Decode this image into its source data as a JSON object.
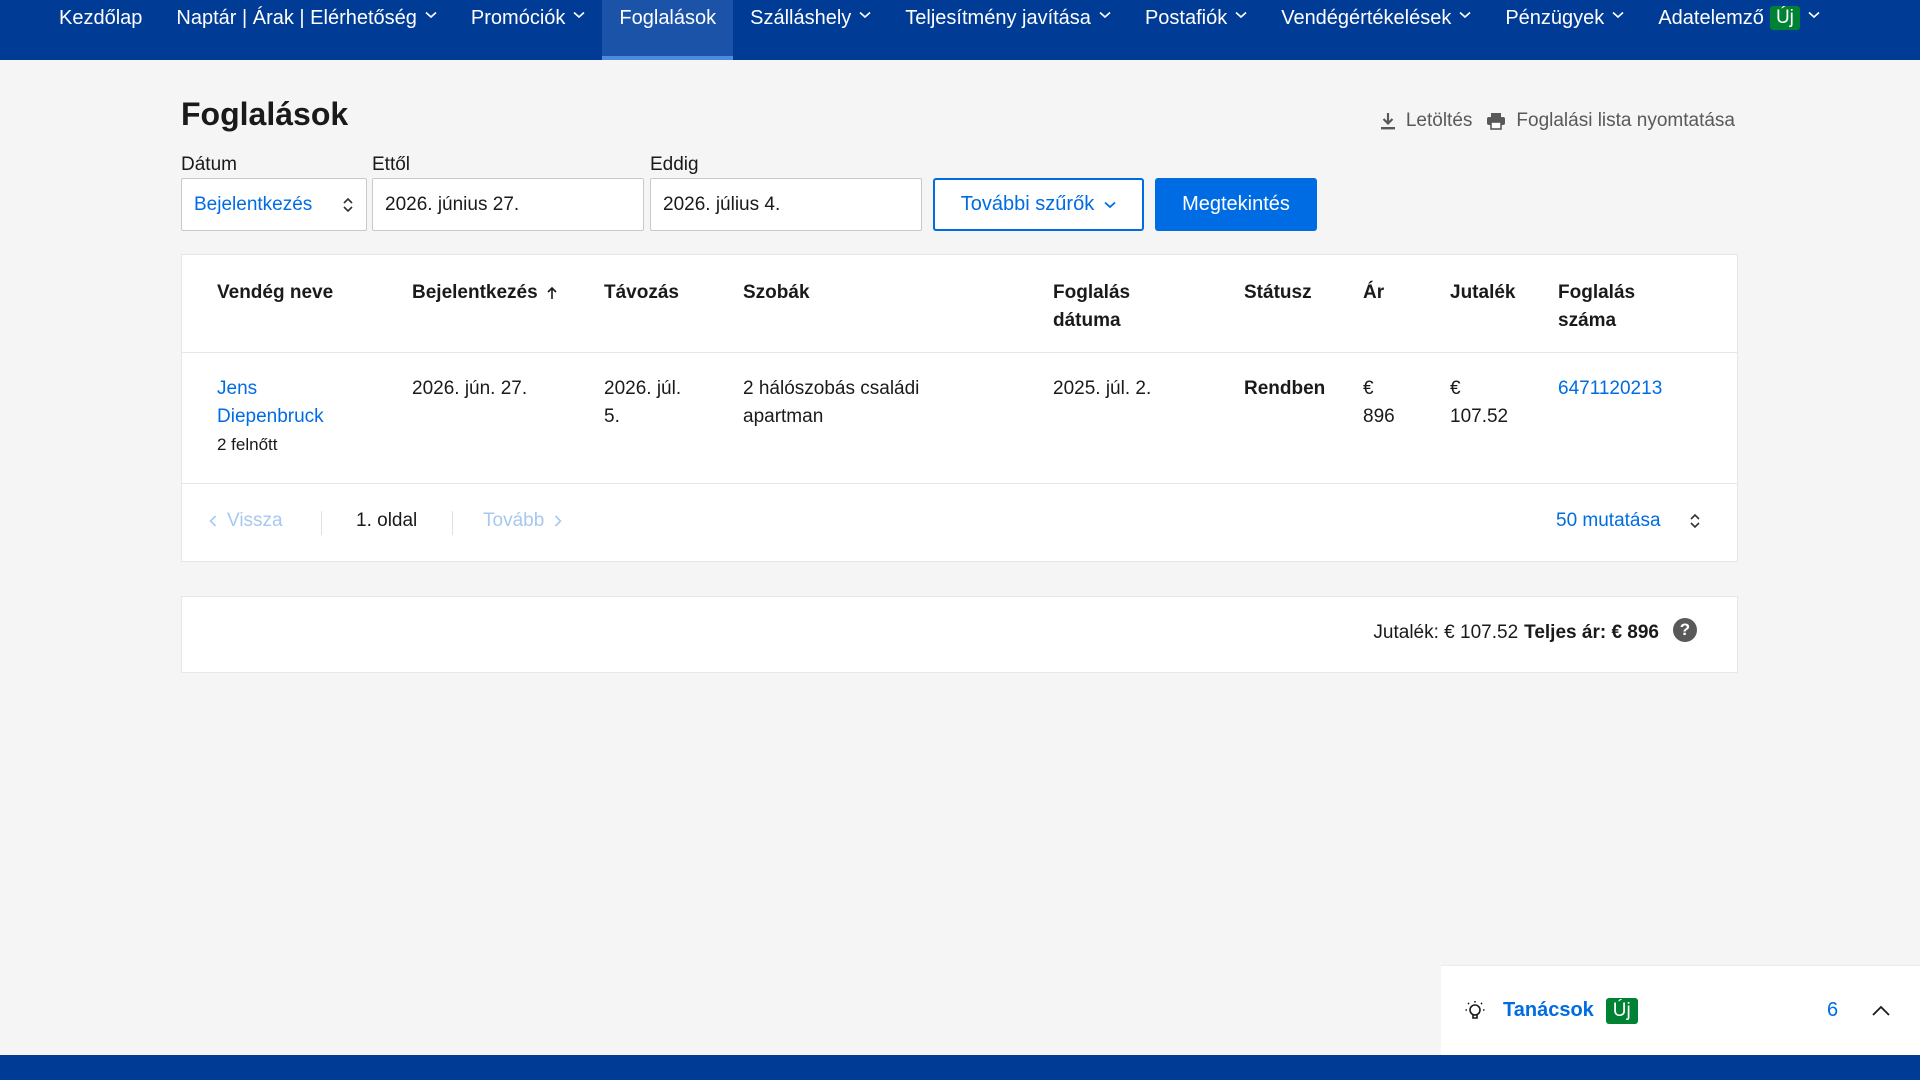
{
  "nav": {
    "items": [
      {
        "label": "Kezdőlap",
        "dropdown": false
      },
      {
        "label": "Naptár | Árak | Elérhetőség",
        "dropdown": true
      },
      {
        "label": "Promóciók",
        "dropdown": true
      },
      {
        "label": "Foglalások",
        "dropdown": false,
        "active": true
      },
      {
        "label": "Szálláshely",
        "dropdown": true
      },
      {
        "label": "Teljesítmény javítása",
        "dropdown": true
      },
      {
        "label": "Postafiók",
        "dropdown": true
      },
      {
        "label": "Vendégértékelések",
        "dropdown": true
      },
      {
        "label": "Pénzügyek",
        "dropdown": true
      },
      {
        "label": "Adatelemző",
        "dropdown": true,
        "badge": "Új"
      }
    ]
  },
  "page": {
    "title": "Foglalások",
    "download_label": "Letöltés",
    "print_label": "Foglalási lista nyomtatása"
  },
  "filters": {
    "date_label": "Dátum",
    "date_type_value": "Bejelentkezés",
    "from_label": "Ettől",
    "from_value": "2026. június 27.",
    "to_label": "Eddig",
    "to_value": "2026. július 4.",
    "more_filters_label": "További szűrők",
    "view_button_label": "Megtekintés"
  },
  "table": {
    "headers": {
      "guest": "Vendég neve",
      "checkin": "Bejelentkezés",
      "checkout": "Távozás",
      "rooms": "Szobák",
      "booking_date_1": "Foglalás",
      "booking_date_2": "dátuma",
      "status": "Státusz",
      "price": "Ár",
      "commission": "Jutalék",
      "booking_no_1": "Foglalás",
      "booking_no_2": "száma"
    },
    "sort": {
      "column": "checkin",
      "direction": "ascending"
    },
    "rows": [
      {
        "guest_first": "Jens",
        "guest_last": "Diepenbruck",
        "guests": "2 felnőtt",
        "checkin": "2026. jún. 27.",
        "checkout_1": "2026. júl.",
        "checkout_2": "5.",
        "rooms_1": "2 hálószobás családi",
        "rooms_2": "apartman",
        "booking_date": "2025. júl. 2.",
        "status": "Rendben",
        "price_1": "€",
        "price_2": "896",
        "commission_1": "€",
        "commission_2": "107.52",
        "booking_no": "6471120213"
      }
    ]
  },
  "pagination": {
    "back_label": "Vissza",
    "page_label": "1. oldal",
    "next_label": "Tovább",
    "per_page_label": "50 mutatása"
  },
  "totals": {
    "commission_text": "Jutalék: € 107.52",
    "total_text": "Teljes ár: € 896",
    "help_glyph": "?"
  },
  "tips": {
    "label": "Tanácsok",
    "badge": "Új",
    "count": "6"
  },
  "colors": {
    "nav_bg": "#003b95",
    "accent": "#006ce4",
    "new_badge": "#008234"
  }
}
